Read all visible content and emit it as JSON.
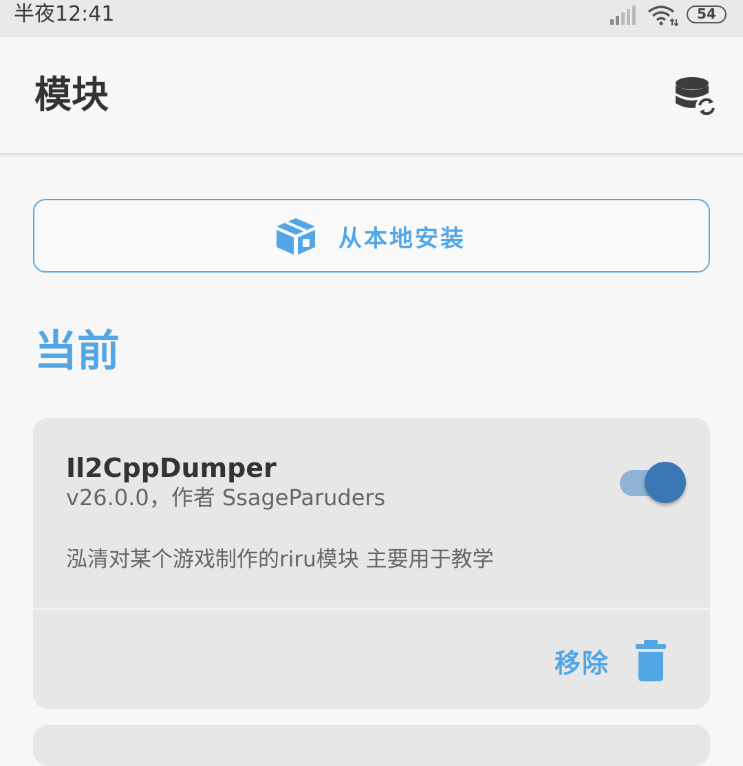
{
  "status_bar": {
    "time": "半夜12:41",
    "battery": "54"
  },
  "app_bar": {
    "title": "模块",
    "action_icon": "database-sync-icon"
  },
  "install": {
    "label": "从本地安装",
    "icon": "package-icon"
  },
  "section": {
    "title": "当前"
  },
  "modules": [
    {
      "name": "Il2CppDumper",
      "meta": "v26.0.0，作者 SsageParuders",
      "description": "泓清对某个游戏制作的riru模块 主要用于教学",
      "enabled": true,
      "remove_label": "移除"
    }
  ],
  "colors": {
    "accent": "#52a6e6",
    "toggle_thumb": "#3a78b5",
    "toggle_track": "#8fb3d6",
    "card_bg": "#e7e7e7",
    "page_bg": "#f7f7f7"
  }
}
